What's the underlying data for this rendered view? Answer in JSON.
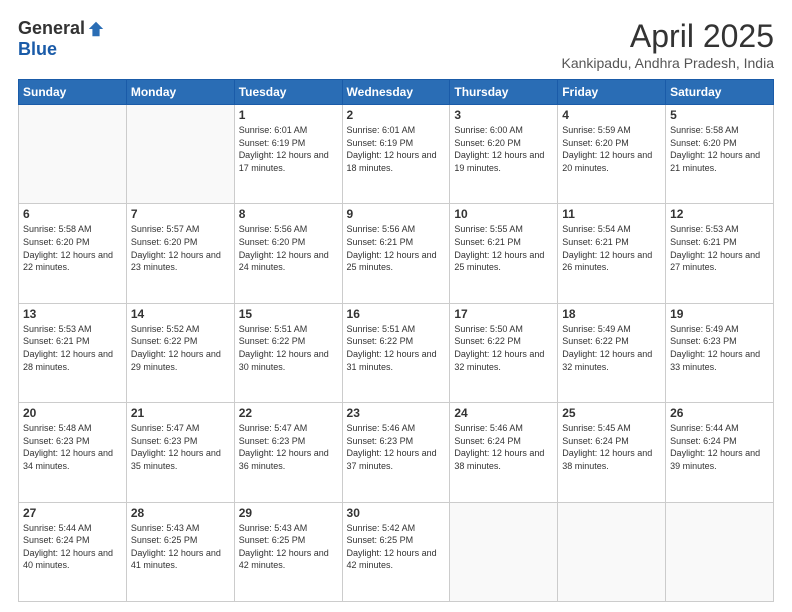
{
  "logo": {
    "general": "General",
    "blue": "Blue"
  },
  "title": "April 2025",
  "subtitle": "Kankipadu, Andhra Pradesh, India",
  "days_of_week": [
    "Sunday",
    "Monday",
    "Tuesday",
    "Wednesday",
    "Thursday",
    "Friday",
    "Saturday"
  ],
  "weeks": [
    [
      {
        "day": "",
        "info": ""
      },
      {
        "day": "",
        "info": ""
      },
      {
        "day": "1",
        "info": "Sunrise: 6:01 AM\nSunset: 6:19 PM\nDaylight: 12 hours and 17 minutes."
      },
      {
        "day": "2",
        "info": "Sunrise: 6:01 AM\nSunset: 6:19 PM\nDaylight: 12 hours and 18 minutes."
      },
      {
        "day": "3",
        "info": "Sunrise: 6:00 AM\nSunset: 6:20 PM\nDaylight: 12 hours and 19 minutes."
      },
      {
        "day": "4",
        "info": "Sunrise: 5:59 AM\nSunset: 6:20 PM\nDaylight: 12 hours and 20 minutes."
      },
      {
        "day": "5",
        "info": "Sunrise: 5:58 AM\nSunset: 6:20 PM\nDaylight: 12 hours and 21 minutes."
      }
    ],
    [
      {
        "day": "6",
        "info": "Sunrise: 5:58 AM\nSunset: 6:20 PM\nDaylight: 12 hours and 22 minutes."
      },
      {
        "day": "7",
        "info": "Sunrise: 5:57 AM\nSunset: 6:20 PM\nDaylight: 12 hours and 23 minutes."
      },
      {
        "day": "8",
        "info": "Sunrise: 5:56 AM\nSunset: 6:20 PM\nDaylight: 12 hours and 24 minutes."
      },
      {
        "day": "9",
        "info": "Sunrise: 5:56 AM\nSunset: 6:21 PM\nDaylight: 12 hours and 25 minutes."
      },
      {
        "day": "10",
        "info": "Sunrise: 5:55 AM\nSunset: 6:21 PM\nDaylight: 12 hours and 25 minutes."
      },
      {
        "day": "11",
        "info": "Sunrise: 5:54 AM\nSunset: 6:21 PM\nDaylight: 12 hours and 26 minutes."
      },
      {
        "day": "12",
        "info": "Sunrise: 5:53 AM\nSunset: 6:21 PM\nDaylight: 12 hours and 27 minutes."
      }
    ],
    [
      {
        "day": "13",
        "info": "Sunrise: 5:53 AM\nSunset: 6:21 PM\nDaylight: 12 hours and 28 minutes."
      },
      {
        "day": "14",
        "info": "Sunrise: 5:52 AM\nSunset: 6:22 PM\nDaylight: 12 hours and 29 minutes."
      },
      {
        "day": "15",
        "info": "Sunrise: 5:51 AM\nSunset: 6:22 PM\nDaylight: 12 hours and 30 minutes."
      },
      {
        "day": "16",
        "info": "Sunrise: 5:51 AM\nSunset: 6:22 PM\nDaylight: 12 hours and 31 minutes."
      },
      {
        "day": "17",
        "info": "Sunrise: 5:50 AM\nSunset: 6:22 PM\nDaylight: 12 hours and 32 minutes."
      },
      {
        "day": "18",
        "info": "Sunrise: 5:49 AM\nSunset: 6:22 PM\nDaylight: 12 hours and 32 minutes."
      },
      {
        "day": "19",
        "info": "Sunrise: 5:49 AM\nSunset: 6:23 PM\nDaylight: 12 hours and 33 minutes."
      }
    ],
    [
      {
        "day": "20",
        "info": "Sunrise: 5:48 AM\nSunset: 6:23 PM\nDaylight: 12 hours and 34 minutes."
      },
      {
        "day": "21",
        "info": "Sunrise: 5:47 AM\nSunset: 6:23 PM\nDaylight: 12 hours and 35 minutes."
      },
      {
        "day": "22",
        "info": "Sunrise: 5:47 AM\nSunset: 6:23 PM\nDaylight: 12 hours and 36 minutes."
      },
      {
        "day": "23",
        "info": "Sunrise: 5:46 AM\nSunset: 6:23 PM\nDaylight: 12 hours and 37 minutes."
      },
      {
        "day": "24",
        "info": "Sunrise: 5:46 AM\nSunset: 6:24 PM\nDaylight: 12 hours and 38 minutes."
      },
      {
        "day": "25",
        "info": "Sunrise: 5:45 AM\nSunset: 6:24 PM\nDaylight: 12 hours and 38 minutes."
      },
      {
        "day": "26",
        "info": "Sunrise: 5:44 AM\nSunset: 6:24 PM\nDaylight: 12 hours and 39 minutes."
      }
    ],
    [
      {
        "day": "27",
        "info": "Sunrise: 5:44 AM\nSunset: 6:24 PM\nDaylight: 12 hours and 40 minutes."
      },
      {
        "day": "28",
        "info": "Sunrise: 5:43 AM\nSunset: 6:25 PM\nDaylight: 12 hours and 41 minutes."
      },
      {
        "day": "29",
        "info": "Sunrise: 5:43 AM\nSunset: 6:25 PM\nDaylight: 12 hours and 42 minutes."
      },
      {
        "day": "30",
        "info": "Sunrise: 5:42 AM\nSunset: 6:25 PM\nDaylight: 12 hours and 42 minutes."
      },
      {
        "day": "",
        "info": ""
      },
      {
        "day": "",
        "info": ""
      },
      {
        "day": "",
        "info": ""
      }
    ]
  ]
}
